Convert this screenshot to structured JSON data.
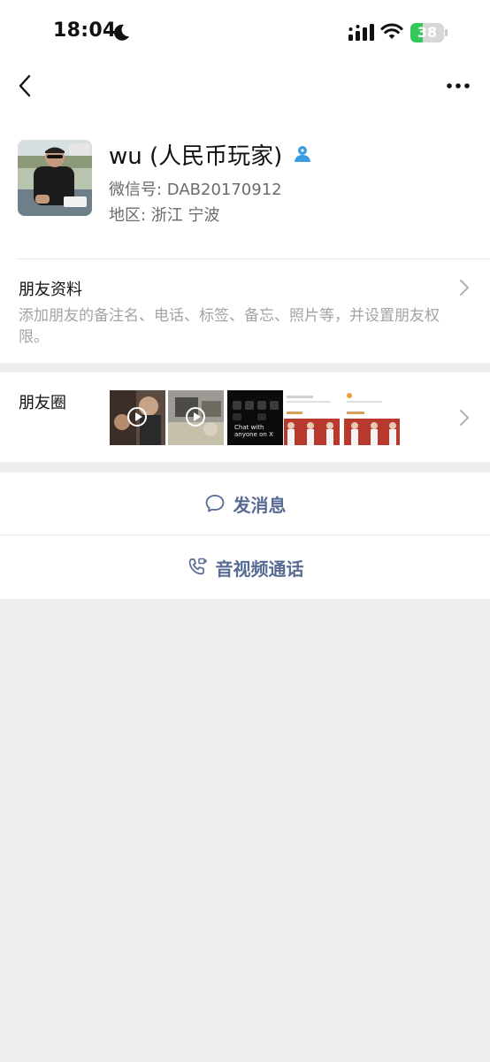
{
  "status_bar": {
    "time": "18:04",
    "battery": "38",
    "battery_level": 0.38,
    "icons": [
      "moon-icon",
      "signal-icon",
      "wifi-icon",
      "battery-icon"
    ]
  },
  "nav": {
    "back_icon": "chevron-left-icon",
    "more_icon": "more-dots-icon"
  },
  "profile": {
    "name": "wu (人民币玩家)",
    "wechat_id": "微信号: DAB20170912",
    "region": "地区: 浙江 宁波",
    "contact_icon": "person-icon"
  },
  "friend_info": {
    "title": "朋友资料",
    "description": "添加朋友的备注名、电话、标签、备忘、照片等，并设置朋友权限。"
  },
  "moments": {
    "title": "朋友圈",
    "thumbs": [
      {
        "kind": "video",
        "name": "moment-thumb-1"
      },
      {
        "kind": "video",
        "name": "moment-thumb-2"
      },
      {
        "kind": "image",
        "name": "moment-thumb-3",
        "text": "Chat with anyone on X"
      },
      {
        "kind": "image",
        "name": "moment-thumb-4"
      },
      {
        "kind": "image",
        "name": "moment-thumb-5"
      }
    ]
  },
  "actions": {
    "send_message": "发消息",
    "av_call": "音视频通话"
  },
  "colors": {
    "accent": "#576b95",
    "background": "#ededed",
    "battery_green": "#34c759",
    "contact_icon": "#3a9bde"
  }
}
